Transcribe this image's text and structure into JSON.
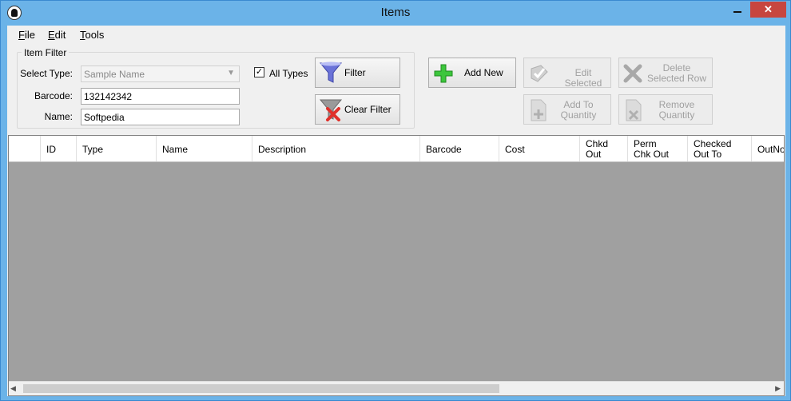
{
  "window": {
    "title": "Items",
    "close_glyph": "✕"
  },
  "menu": [
    {
      "underline": "F",
      "rest": "ile"
    },
    {
      "underline": "E",
      "rest": "dit"
    },
    {
      "underline": "T",
      "rest": "ools"
    }
  ],
  "filter": {
    "group_title": "Item Filter",
    "select_type_label": "Select Type:",
    "select_type_value": "Sample Name",
    "barcode_label": "Barcode:",
    "barcode_value": "132142342",
    "name_label": "Name:",
    "name_value": "Softpedia",
    "all_types_label": "All Types",
    "all_types_checked": true,
    "filter_button": "Filter",
    "clear_filter_button": "Clear Filter"
  },
  "actions": {
    "add_new": "Add New",
    "edit_selected": "Edit Selected",
    "delete_line1": "Delete",
    "delete_line2": "Selected Row",
    "add_qty_line1": "Add To",
    "add_qty_line2": "Quantity",
    "remove_qty_line1": "Remove",
    "remove_qty_line2": "Quantity"
  },
  "grid": {
    "columns": [
      {
        "line1": "ID",
        "line2": ""
      },
      {
        "line1": "Type",
        "line2": ""
      },
      {
        "line1": "Name",
        "line2": ""
      },
      {
        "line1": "Description",
        "line2": ""
      },
      {
        "line1": "Barcode",
        "line2": ""
      },
      {
        "line1": "Cost",
        "line2": ""
      },
      {
        "line1": "Chkd",
        "line2": "Out"
      },
      {
        "line1": "Perm",
        "line2": "Chk Out"
      },
      {
        "line1": "Checked",
        "line2": "Out To"
      },
      {
        "line1": "OutNot",
        "line2": ""
      }
    ],
    "rows": []
  },
  "colors": {
    "titlebar": "#6bb3e8",
    "close_button": "#c7463f",
    "grid_background": "#a0a0a0",
    "add_icon": "#3cc63c",
    "clear_icon": "#e0302a",
    "funnel": "#6a72d8"
  },
  "icons": [
    "app-icon",
    "minimize-icon",
    "maximize-icon",
    "close-icon",
    "funnel-icon",
    "clear-filter-icon",
    "plus-icon",
    "edit-icon",
    "delete-icon",
    "add-quantity-icon",
    "remove-quantity-icon"
  ]
}
